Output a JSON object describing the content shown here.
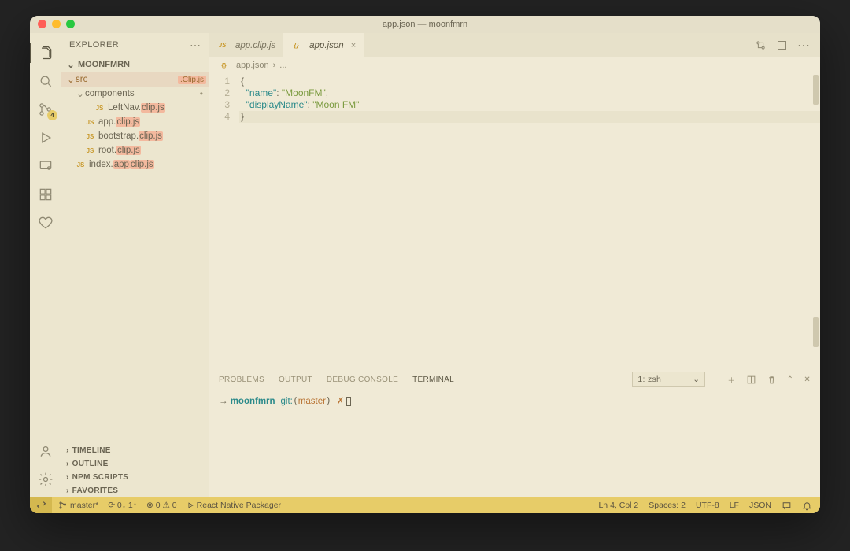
{
  "titlebar": "app.json — moonfmrn",
  "explorer": {
    "title": "EXPLORER",
    "project": "MOONFMRN"
  },
  "activity_badge": "4",
  "tree": {
    "src_label": "src",
    "src_ext_badge": ".Clip.js",
    "components_label": "components",
    "file_leftnav_pre": "LeftNav.",
    "file_leftnav_hl": "clip.js",
    "file_app_pre": "app.",
    "file_app_hl": "clip.js",
    "file_bootstrap_pre": "bootstrap.",
    "file_bootstrap_hl": "clip.js",
    "file_root_pre": "root.",
    "file_root_hl": "clip.js",
    "file_index_pre": "index.",
    "file_index_mid": "app",
    "file_index_hl": "clip.js"
  },
  "sidebar_sections": {
    "timeline": "TIMELINE",
    "outline": "OUTLINE",
    "npm": "NPM SCRIPTS",
    "favorites": "FAVORITES"
  },
  "tabs": {
    "tab1": "app.clip.js",
    "tab2": "app.json",
    "close": "×"
  },
  "breadcrumb": {
    "file": "app.json",
    "sep": "›",
    "rest": "..."
  },
  "code": {
    "l1": "{",
    "l2_key": "\"name\"",
    "l2_val": "\"MoonFM\"",
    "l3_key": "\"displayName\"",
    "l3_val": "\"Moon FM\"",
    "l4": "}"
  },
  "panel": {
    "problems": "PROBLEMS",
    "output": "OUTPUT",
    "debug": "DEBUG CONSOLE",
    "terminal": "TERMINAL",
    "term_select": "1: zsh"
  },
  "terminal": {
    "dir": "moonfmrn",
    "git": "git:",
    "branch": "master",
    "sym": "✗"
  },
  "status": {
    "branch": "master*",
    "sync": "⟳ 0↓ 1↑",
    "errwarn": "⊗ 0 ⚠ 0",
    "packager": "React Native Packager",
    "ln": "Ln 4, Col 2",
    "spaces": "Spaces: 2",
    "enc": "UTF-8",
    "eol": "LF",
    "lang": "JSON"
  }
}
